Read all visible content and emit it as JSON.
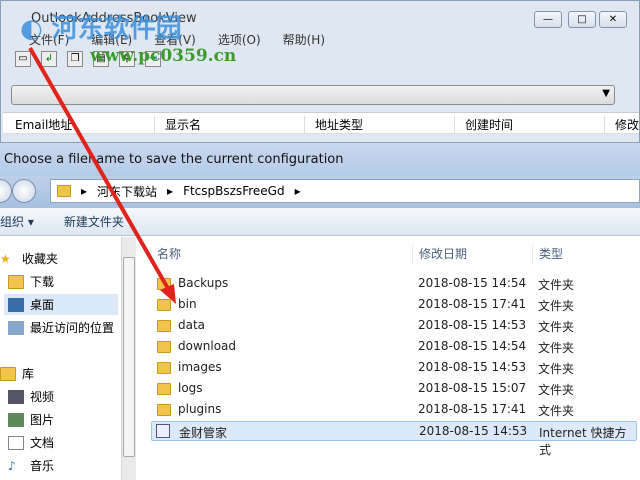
{
  "main_window": {
    "title": "OutlookAddressBookView",
    "menu": [
      "文件(F)",
      "编辑(E)",
      "查看(V)",
      "选项(O)",
      "帮助(H)"
    ],
    "columns": [
      "Email地址",
      "显示名",
      "地址类型",
      "创建时间",
      "修改"
    ]
  },
  "watermark": {
    "name": "河东软件园",
    "url": "www.pc0359.cn"
  },
  "dialog": {
    "title": "Choose a filename to save the current configuration",
    "path": [
      "河东下载站",
      "FtcspBszsFreeGd"
    ],
    "organize": "组织 ▾",
    "new_folder": "新建文件夹",
    "nav": [
      {
        "label": "收藏夹",
        "icon": "star-icon"
      },
      {
        "label": "下载",
        "icon": "download-folder-icon"
      },
      {
        "label": "桌面",
        "icon": "desktop-icon"
      },
      {
        "label": "最近访问的位置",
        "icon": "recent-icon"
      },
      {
        "label": "库",
        "icon": "library-icon"
      },
      {
        "label": "视频",
        "icon": "video-icon"
      },
      {
        "label": "图片",
        "icon": "picture-icon"
      },
      {
        "label": "文档",
        "icon": "document-icon"
      },
      {
        "label": "音乐",
        "icon": "music-icon"
      }
    ],
    "headers": [
      "名称",
      "修改日期",
      "类型"
    ],
    "files": [
      {
        "name": "Backups",
        "date": "2018-08-15 14:54",
        "type": "文件夹"
      },
      {
        "name": "bin",
        "date": "2018-08-15 17:41",
        "type": "文件夹"
      },
      {
        "name": "data",
        "date": "2018-08-15 14:53",
        "type": "文件夹"
      },
      {
        "name": "download",
        "date": "2018-08-15 14:54",
        "type": "文件夹"
      },
      {
        "name": "images",
        "date": "2018-08-15 14:53",
        "type": "文件夹"
      },
      {
        "name": "logs",
        "date": "2018-08-15 15:07",
        "type": "文件夹"
      },
      {
        "name": "plugins",
        "date": "2018-08-15 17:41",
        "type": "文件夹"
      },
      {
        "name": "金财管家",
        "date": "2018-08-15 14:53",
        "type": "Internet 快捷方式"
      }
    ]
  }
}
